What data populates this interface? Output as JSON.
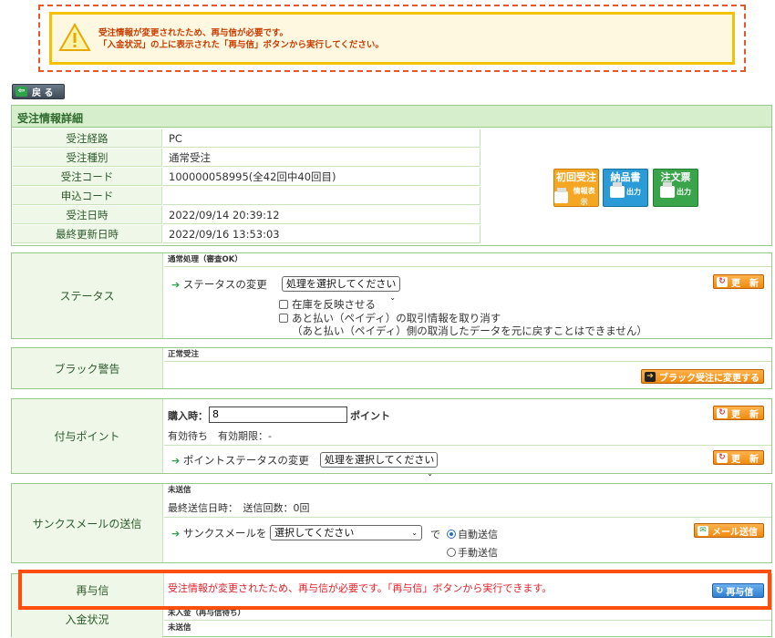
{
  "alert": {
    "line1": "受注情報が変更されたため、再与信が必要です。",
    "line2": "「入金状況」の上に表示された「再与信」ボタンから実行してください。"
  },
  "back_label": "戻 る",
  "detail": {
    "title": "受注情報詳細",
    "rows": [
      {
        "label": "受注経路",
        "value": "PC"
      },
      {
        "label": "受注種別",
        "value": "通常受注"
      },
      {
        "label": "受注コード",
        "value": "100000058995(全42回中40回目)"
      },
      {
        "label": "申込コード",
        "value": ""
      },
      {
        "label": "受注日時",
        "value": "2022/09/14 20:39:12"
      },
      {
        "label": "最終更新日時",
        "value": "2022/09/16 13:53:03"
      }
    ],
    "buttons": {
      "first_order": {
        "top": "初回受注",
        "sub": "情報表示",
        "color": "#f5a623"
      },
      "delivery": {
        "top": "納品書",
        "sub": "出力",
        "color": "#2a9bd6"
      },
      "order": {
        "top": "注文票",
        "sub": "出力",
        "color": "#3aa44a"
      }
    }
  },
  "status": {
    "label": "ステータス",
    "head": "通常処理（審査OK）",
    "change_label": "ステータスの変更",
    "select_value": "処理を選択してください",
    "check1": "在庫を反映させる",
    "check2": "あと払い（ペイディ）の取引情報を取り消す",
    "note": "（あと払い（ペイディ）側の取消したデータを元に戻すことはできません）",
    "update_label": "更　新"
  },
  "black": {
    "label": "ブラック警告",
    "head": "正常受注",
    "button": "ブラック受注に変更する"
  },
  "points": {
    "label": "付与ポイント",
    "purchase_label": "購入時：",
    "purchase_value": "8",
    "unit": "ポイント",
    "validity": "有効待ち　有効期限：-",
    "change_label": "ポイントステータスの変更",
    "select_value": "処理を選択してください",
    "update_label": "更　新"
  },
  "thanks": {
    "label": "サンクスメールの送信",
    "head": "未送信",
    "last_sent": "最終送信日時：　送信回数：0回",
    "send_label": "サンクスメールを",
    "select_value": "選択してください",
    "de": "で",
    "auto": "自動送信",
    "manual": "手動送信",
    "button": "メール送信"
  },
  "resend": {
    "label": "再与信",
    "message": "受注情報が変更されたため、再与信が必要です。「再与信」ボタンから実行できます。",
    "button": "再与信"
  },
  "payment": {
    "label": "入金状況",
    "head": "未入金（再与信待ち）",
    "sub": "未送信"
  }
}
